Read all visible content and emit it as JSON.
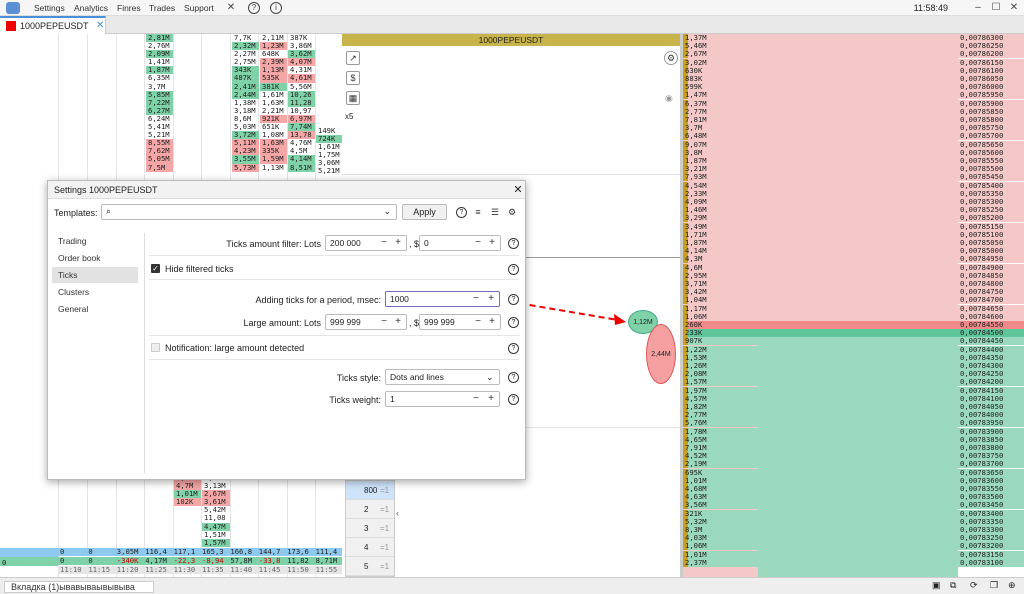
{
  "menu": {
    "items": [
      "Settings",
      "Analytics",
      "Finres",
      "Trades",
      "Support"
    ],
    "clock": "11:58:49"
  },
  "tab": {
    "label": "1000PEPEUSDT"
  },
  "chart": {
    "title": "1000PEPEUSDT",
    "multiplier": "x5"
  },
  "bubbles": {
    "a": "1,12M",
    "b": "2,44M"
  },
  "left_cols": {
    "col1": [
      "",
      "",
      "",
      "",
      "",
      "",
      "",
      "",
      "",
      "",
      "",
      "",
      "",
      "",
      "",
      "",
      "",
      "",
      "",
      "",
      "",
      "",
      "",
      "",
      "",
      "",
      "",
      "",
      "",
      "",
      "",
      "",
      "",
      "",
      "",
      "",
      "",
      "",
      "",
      "",
      "",
      "",
      "",
      "",
      "",
      "",
      "",
      "",
      "",
      "",
      "",
      "",
      "",
      "",
      "",
      "",
      "",
      "",
      "",
      "",
      "",
      "",
      "",
      "",
      "",
      "",
      "",
      "0"
    ],
    "col2": [
      "0"
    ],
    "top_a": [
      "2,81M",
      "2,76M",
      "2,09M",
      "1,41M",
      "1,87M",
      "6,35M",
      "3,7M",
      "5,85M",
      "7,22M",
      "6,27M",
      "6,24M",
      "5,41M",
      "5,21M",
      "8,55M",
      "7,62M",
      "5,05M",
      "7,5M"
    ],
    "top_a_colors": [
      "g",
      "w",
      "g",
      "w",
      "g",
      "w",
      "w",
      "g",
      "g",
      "g",
      "w",
      "w",
      "w",
      "r",
      "r",
      "r",
      "r"
    ],
    "top_b": [
      "7,7K",
      "2,32M",
      "2,27M",
      "2,75M",
      "343K",
      "487K",
      "2,41M",
      "2,44M",
      "1,38M",
      "3,18M",
      "8,6M",
      "5,03M",
      "3,72M",
      "5,11M",
      "4,23M",
      "3,55M",
      "5,73M"
    ],
    "top_b_colors": [
      "w",
      "g",
      "w",
      "w",
      "g",
      "g",
      "g",
      "g",
      "w",
      "w",
      "w",
      "w",
      "g",
      "r",
      "r",
      "g",
      "r"
    ],
    "top_c": [
      "2,11M",
      "1,23M",
      "648K",
      "2,39M",
      "1,13M",
      "535K",
      "381K",
      "1,61M",
      "1,63M",
      "2,21M",
      "921K",
      "651K",
      "1,08M",
      "1,63M",
      "335K",
      "1,59M",
      "1,13M"
    ],
    "top_c_colors": [
      "w",
      "r",
      "w",
      "r",
      "r",
      "r",
      "g",
      "w",
      "w",
      "w",
      "r",
      "w",
      "w",
      "r",
      "r",
      "r",
      "w"
    ],
    "top_d": [
      "387K",
      "3,86M",
      "3,62M",
      "4,07M",
      "4,31M",
      "4,61M",
      "5,56M",
      "10,26",
      "11,28",
      "10,97",
      "6,97M",
      "7,74M",
      "13,78",
      "4,76M",
      "4,5M",
      "4,14M",
      "8,51M"
    ],
    "top_d_colors": [
      "w",
      "w",
      "g",
      "r",
      "w",
      "r",
      "w",
      "g",
      "g",
      "w",
      "r",
      "g",
      "r",
      "w",
      "w",
      "g",
      "g"
    ],
    "top_e": [
      "149K",
      "724K",
      "1,61M",
      "1,75M",
      "3,06M",
      "5,21M"
    ],
    "bottom_b": [
      "5,47M",
      "4,7M",
      "1,01M",
      "102K"
    ],
    "bottom_b_colors": [
      "r",
      "r",
      "g",
      "r"
    ],
    "bottom_c": [
      "4,57M",
      "3,13M",
      "2,67M",
      "3,61M",
      "5,42M",
      "11,08",
      "4,47M",
      "1,51M",
      "1,57M"
    ],
    "bottom_c_colors": [
      "w",
      "w",
      "r",
      "r",
      "w",
      "w",
      "g",
      "w",
      "g"
    ],
    "totals_1": [
      "0",
      "0",
      "3,05M",
      "116,4",
      "117,1",
      "165,3",
      "166,8",
      "144,7",
      "173,6",
      "111,4"
    ],
    "totals_2": [
      "0",
      "0",
      "-340K",
      "4,17M",
      "-22,3",
      "-8,94",
      "57,8M",
      "-33,8",
      "11,82",
      "8,71M"
    ],
    "times": [
      "11:10",
      "11:15",
      "11:20",
      "11:25",
      "11:30",
      "11:35",
      "11:40",
      "11:45",
      "11:50",
      "11:55"
    ]
  },
  "ladder": {
    "volumes": [
      "1,37M",
      "5,46M",
      "2,67M",
      "3,02M",
      "630K",
      "883K",
      "599K",
      "1,47M",
      "6,37M",
      "2,77M",
      "7,81M",
      "3,7M",
      "6,48M",
      "9,07M",
      "3,8M",
      "1,87M",
      "3,21M",
      "7,93M",
      "4,54M",
      "2,33M",
      "4,09M",
      "1,46M",
      "3,29M",
      "3,49M",
      "1,71M",
      "1,87M",
      "4,14M",
      "4,3M",
      "4,6M",
      "2,95M",
      "3,71M",
      "3,42M",
      "1,04M",
      "1,17M",
      "1,06M",
      "260K",
      "233K",
      "907K",
      "1,22M",
      "1,53M",
      "1,26M",
      "2,08M",
      "1,57M",
      "1,97M",
      "4,57M",
      "1,82M",
      "2,77M",
      "5,76M",
      "1,78M",
      "4,65M",
      "7,91M",
      "4,52M",
      "2,19M",
      "695K",
      "1,01M",
      "4,68M",
      "4,63M",
      "3,56M",
      "321K",
      "5,32M",
      "8,3M",
      "4,03M",
      "1,06M",
      "1,01M",
      "2,37M"
    ],
    "prices": [
      "0,00786300",
      "0,00786250",
      "0,00786200",
      "0,00786150",
      "0,00786100",
      "0,00786050",
      "0,00786000",
      "0,00785950",
      "0,00785900",
      "0,00785850",
      "0,00785800",
      "0,00785750",
      "0,00785700",
      "0,00785650",
      "0,00785600",
      "0,00785550",
      "0,00785500",
      "0,00785450",
      "0,00785400",
      "0,00785350",
      "0,00785300",
      "0,00785250",
      "0,00785200",
      "0,00785150",
      "0,00785100",
      "0,00785050",
      "0,00785000",
      "0,00784950",
      "0,00784900",
      "0,00784850",
      "0,00784800",
      "0,00784750",
      "0,00784700",
      "0,00784650",
      "0,00784600",
      "0,00784550",
      "0,00784500",
      "0,00784450",
      "0,00784400",
      "0,00784350",
      "0,00784300",
      "0,00784250",
      "0,00784200",
      "0,00784150",
      "0,00784100",
      "0,00784050",
      "0,00784000",
      "0,00783950",
      "0,00783900",
      "0,00783850",
      "0,00783800",
      "0,00783750",
      "0,00783700",
      "0,00783650",
      "0,00783600",
      "0,00783550",
      "0,00783500",
      "0,00783450",
      "0,00783400",
      "0,00783350",
      "0,00783300",
      "0,00783250",
      "0,00783200",
      "0,00783150",
      "0,00783100"
    ],
    "ask_color": "#f5c8c8",
    "bid_color": "#9ad9bd",
    "best_ask_color": "#f08a8a",
    "best_bid_color": "#5ec79a",
    "vol_bar_color": "#c8a020"
  },
  "scale_list": {
    "items": [
      {
        "n": "800",
        "m": "=1"
      },
      {
        "n": "2",
        "m": "=1"
      },
      {
        "n": "3",
        "m": "=1"
      },
      {
        "n": "4",
        "m": "=1"
      },
      {
        "n": "5",
        "m": "=1"
      }
    ]
  },
  "dialog": {
    "title": "Settings 1000PEPEUSDT",
    "templates_label": "Templates:",
    "apply": "Apply",
    "nav": [
      "Trading",
      "Order book",
      "Ticks",
      "Clusters",
      "General"
    ],
    "ticks_filter_label": "Ticks amount filter: Lots",
    "ticks_filter_lots": "200 000",
    "ticks_filter_usd": "0",
    "usd_sep": ", $",
    "hide_filtered": "Hide filtered ticks",
    "adding_label": "Adding ticks for a period, msec:",
    "adding_value": "1000",
    "large_label": "Large amount: Lots",
    "large_lots": "999 999",
    "large_usd": "999 999",
    "notification": "Notification: large amount detected",
    "style_label": "Ticks style:",
    "style_value": "Dots and lines",
    "weight_label": "Ticks weight:",
    "weight_value": "1"
  },
  "bottom": {
    "tab_label": "Вкладка (1)ывавываывывыва"
  }
}
